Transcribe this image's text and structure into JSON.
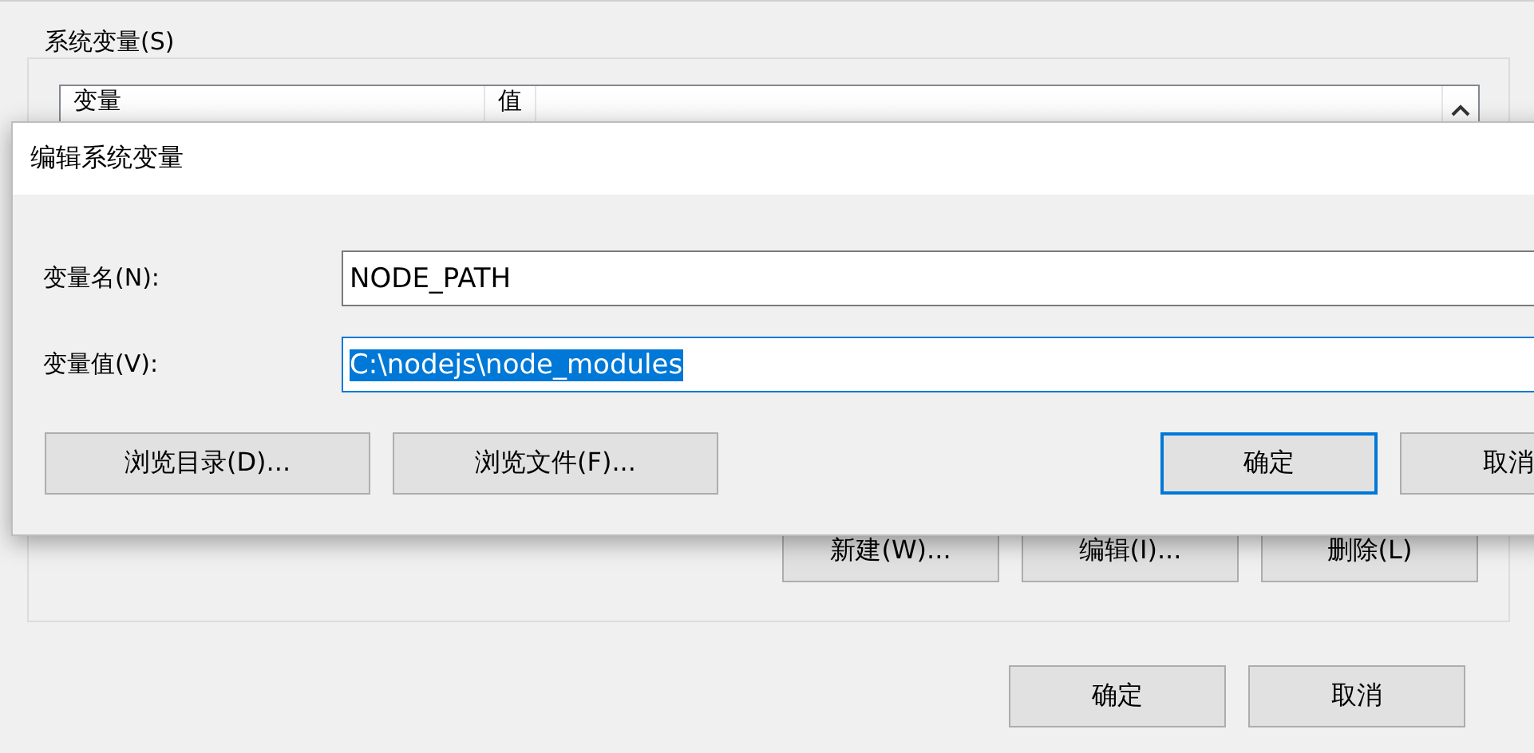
{
  "background_window": {
    "group_title": "系统变量(S)",
    "table": {
      "columns": [
        "变量",
        "值"
      ]
    },
    "list_buttons": [
      {
        "label": "新建(W)..."
      },
      {
        "label": "编辑(I)..."
      },
      {
        "label": "删除(L)"
      }
    ],
    "footer_buttons": [
      {
        "label": "确定"
      },
      {
        "label": "取消"
      }
    ]
  },
  "dialog": {
    "title": "编辑系统变量",
    "fields": [
      {
        "label": "变量名(N):",
        "value": "NODE_PATH",
        "focused": false,
        "value_selected": false
      },
      {
        "label": "变量值(V):",
        "value": "C:\\nodejs\\node_modules",
        "focused": true,
        "value_selected": true
      }
    ],
    "buttons": [
      {
        "label": "浏览目录(D)...",
        "default": false
      },
      {
        "label": "浏览文件(F)...",
        "default": false
      },
      {
        "label": "确定",
        "default": true
      },
      {
        "label": "取消",
        "default": false
      }
    ]
  }
}
